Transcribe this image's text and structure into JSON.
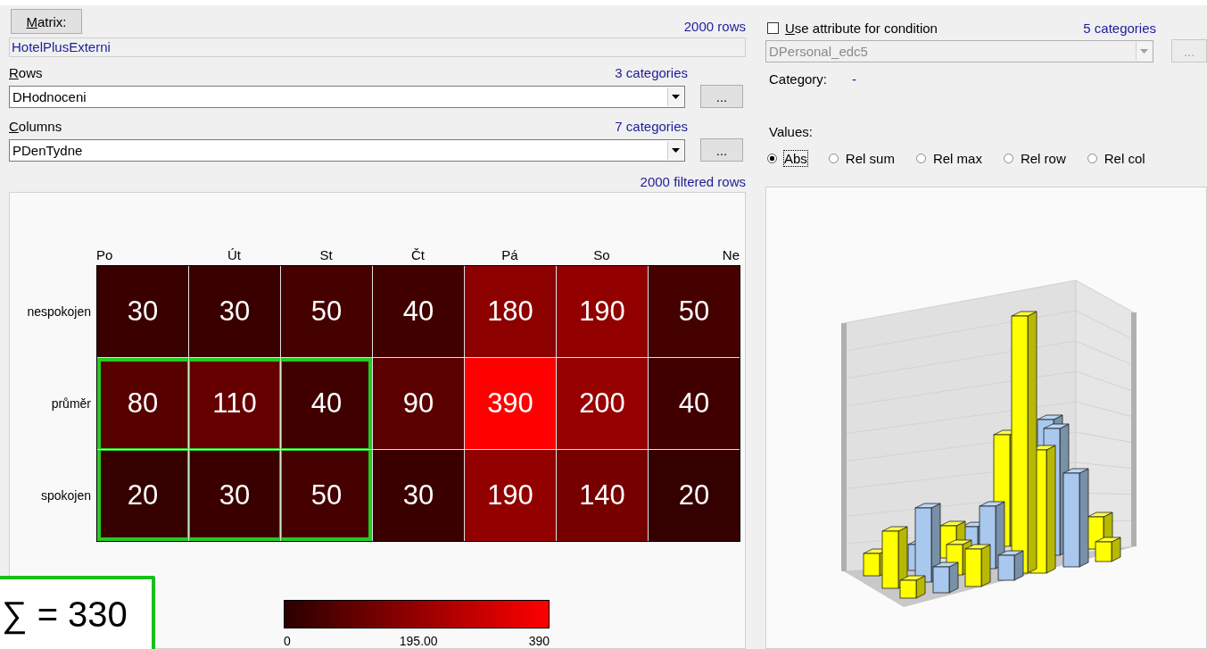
{
  "matrix_button": {
    "label": "Matrix:"
  },
  "row_count": "2000 rows",
  "source": {
    "value": "HotelPlusExterni"
  },
  "rows_field": {
    "label": "Rows",
    "count": "3 categories",
    "value": "DHodnoceni",
    "button": "..."
  },
  "columns_field": {
    "label": "Columns",
    "count": "7 categories",
    "value": "PDenTydne",
    "button": "..."
  },
  "filtered_count": "2000 filtered rows",
  "condition": {
    "label": "Use attribute for condition",
    "checked": false,
    "count": "5 categories",
    "value": "DPersonal_edc5",
    "disabled": true,
    "button": "..."
  },
  "category": {
    "label": "Category:",
    "value": "-"
  },
  "values": {
    "label": "Values:",
    "options": [
      {
        "label": "Abs",
        "selected": true
      },
      {
        "label": "Rel sum",
        "selected": false
      },
      {
        "label": "Rel max",
        "selected": false
      },
      {
        "label": "Rel row",
        "selected": false
      },
      {
        "label": "Rel col",
        "selected": false
      }
    ]
  },
  "heatmap": {
    "columns": [
      "Po",
      "Út",
      "St",
      "Čt",
      "Pá",
      "So",
      "Ne"
    ],
    "rows": [
      {
        "label": "nespokojen",
        "cells": [
          {
            "value": "30",
            "color": "#3a0000",
            "highlighted": false
          },
          {
            "value": "30",
            "color": "#3a0000",
            "highlighted": false
          },
          {
            "value": "50",
            "color": "#450000",
            "highlighted": false
          },
          {
            "value": "40",
            "color": "#400000",
            "highlighted": false
          },
          {
            "value": "180",
            "color": "#8c0000",
            "highlighted": false
          },
          {
            "value": "190",
            "color": "#920000",
            "highlighted": false
          },
          {
            "value": "50",
            "color": "#450000",
            "highlighted": false
          }
        ]
      },
      {
        "label": "průměr",
        "cells": [
          {
            "value": "80",
            "color": "#560000",
            "highlighted": true
          },
          {
            "value": "110",
            "color": "#660000",
            "highlighted": true
          },
          {
            "value": "40",
            "color": "#400000",
            "highlighted": true
          },
          {
            "value": "90",
            "color": "#5b0000",
            "highlighted": false
          },
          {
            "value": "390",
            "color": "#ff0000",
            "highlighted": false
          },
          {
            "value": "200",
            "color": "#970000",
            "highlighted": false
          },
          {
            "value": "40",
            "color": "#400000",
            "highlighted": false
          }
        ]
      },
      {
        "label": "spokojen",
        "cells": [
          {
            "value": "20",
            "color": "#350000",
            "highlighted": true
          },
          {
            "value": "30",
            "color": "#3a0000",
            "highlighted": true
          },
          {
            "value": "50",
            "color": "#450000",
            "highlighted": true
          },
          {
            "value": "30",
            "color": "#3a0000",
            "highlighted": false
          },
          {
            "value": "190",
            "color": "#920000",
            "highlighted": false
          },
          {
            "value": "140",
            "color": "#760000",
            "highlighted": false
          },
          {
            "value": "20",
            "color": "#350000",
            "highlighted": false
          }
        ]
      }
    ]
  },
  "color_scale": {
    "min": "0",
    "mid": "195.00",
    "max": "390"
  },
  "sum_box": {
    "text": "∑ = 330"
  }
}
